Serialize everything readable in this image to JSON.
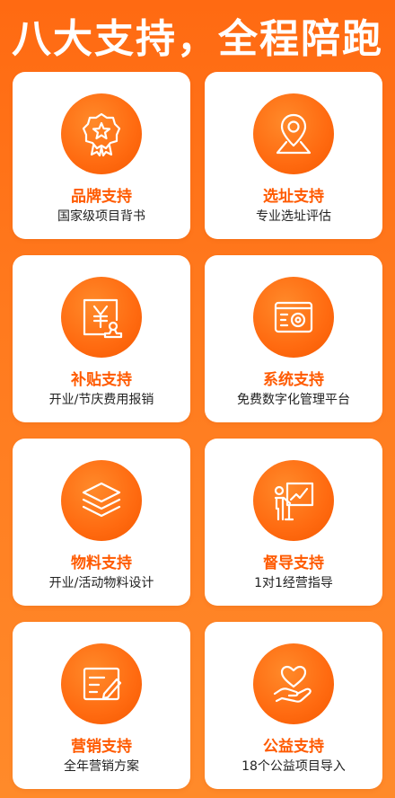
{
  "header": {
    "title": "八大支持，全程陪跑"
  },
  "cards": [
    {
      "title": "品牌支持",
      "subtitle": "国家级项目背书",
      "icon": "award-badge-icon"
    },
    {
      "title": "选址支持",
      "subtitle": "专业选址评估",
      "icon": "location-pin-icon"
    },
    {
      "title": "补贴支持",
      "subtitle": "开业/节庆费用报销",
      "icon": "yuan-stamp-icon"
    },
    {
      "title": "系统支持",
      "subtitle": "免费数字化管理平台",
      "icon": "camera-system-icon"
    },
    {
      "title": "物料支持",
      "subtitle": "开业/活动物料设计",
      "icon": "layers-icon"
    },
    {
      "title": "督导支持",
      "subtitle": "1对1经营指导",
      "icon": "presentation-icon"
    },
    {
      "title": "营销支持",
      "subtitle": "全年营销方案",
      "icon": "edit-document-icon"
    },
    {
      "title": "公益支持",
      "subtitle": "18个公益项目导入",
      "icon": "heart-hand-icon"
    }
  ],
  "colors": {
    "background": "#ff7a1e",
    "accent": "#ff5a00",
    "card": "#ffffff"
  }
}
